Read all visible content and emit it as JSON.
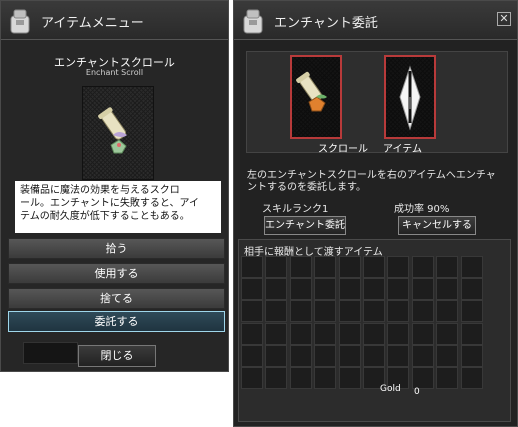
{
  "item_menu": {
    "title": "アイテムメニュー",
    "item_name_jp": "エンチャントスクロール",
    "item_name_en": "Enchant Scroll",
    "description": "装備品に魔法の効果を与えるスクロ\nール。エンチャントに失敗すると、アイ\nテムの耐久度が低下することもある。",
    "menu": [
      "拾う",
      "使用する",
      "捨てる",
      "委託する"
    ],
    "selected_index": 3,
    "close_label": "閉じる"
  },
  "enchant_window": {
    "title": "エンチャント委託",
    "close_glyph": "✕",
    "scroll_label": "スクロール",
    "item_label": "アイテム",
    "info": "左のエンチャントスクロールを右のアイテムへエンチャントするのを委託します。",
    "skill_rank": "スキルランク1",
    "success_rate": "成功率 90%",
    "enchant_button": "エンチャント委託",
    "cancel_button": "キャンセルする",
    "reward_title": "相手に報酬として渡すアイテム",
    "gold_label": "Gold",
    "gold_value": "0"
  },
  "icons": [
    "menu-bag-icon",
    "enchant-bag-icon",
    "enchant-scroll-icon",
    "lance-icon",
    "close-icon"
  ]
}
